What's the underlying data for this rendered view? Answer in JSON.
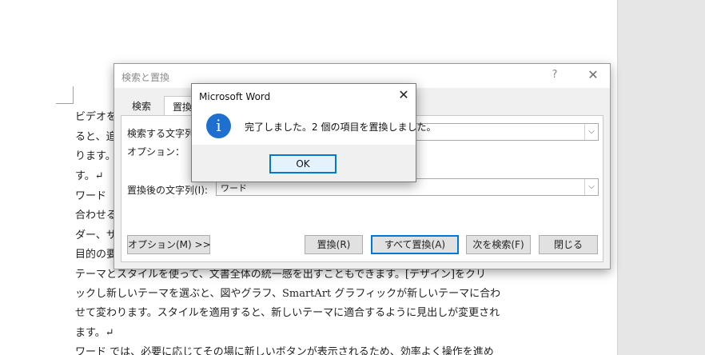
{
  "document": {
    "lines": [
      "ビデオを",
      "ると、追",
      "ります。サ",
      "す。↵",
      "ワード",
      "合わせる",
      "ダー、サ",
      "目的の要",
      "テーマとスタイルを使って、文書全体の統一感を出すこともできます。[デザイン]をクリ",
      "ックし新しいテーマを選ぶと、図やグラフ、SmartArt グラフィックが新しいテーマに合わ",
      "せて変わります。スタイルを適用すると、新しいテーマに適合するように見出しが変更され",
      "ます。↵",
      "ワード では、必要に応じてその場に新しいボタンが表示されるため、効率よく操作を進め"
    ]
  },
  "find_replace": {
    "title": "検索と置換",
    "help": "?",
    "close": "✕",
    "tabs": [
      "検索",
      "置換"
    ],
    "search_label": "検索する文字列(",
    "search_value": "",
    "options_label": "オプション：",
    "replace_label": "置換後の文字列(I):",
    "replace_value": "ワード",
    "buttons": {
      "options": "オプション(M) >>",
      "replace": "置換(R)",
      "replace_all": "すべて置換(A)",
      "find_next": "次を検索(F)",
      "close": "閉じる"
    }
  },
  "message_box": {
    "title": "Microsoft Word",
    "close": "✕",
    "icon": "info-icon",
    "icon_glyph": "i",
    "text": "完了しました。2 個の項目を置換しました。",
    "ok": "OK"
  },
  "colors": {
    "accent": "#0078d7",
    "info_icon": "#1f6fd1",
    "dialog_bg": "#f0f0f0"
  }
}
